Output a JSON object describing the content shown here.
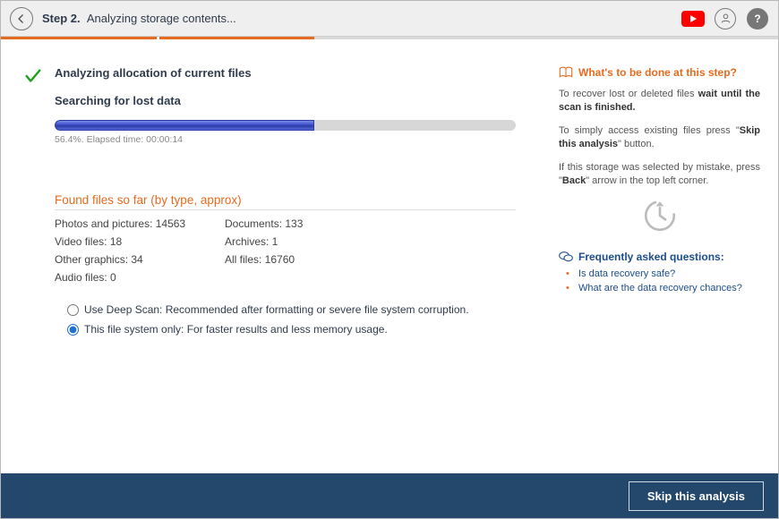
{
  "header": {
    "step_prefix": "Step 2.",
    "step_title": "Analyzing storage contents..."
  },
  "wizard_progress": {
    "done_pct": 41
  },
  "main": {
    "analyzing_title": "Analyzing allocation of current files",
    "searching_title": "Searching for lost data",
    "progress_pct": 56.4,
    "progress_caption": "56.4%. Elapsed time: 00:00:14",
    "found_heading": "Found files so far (by type, approx)",
    "found": {
      "photos": "Photos and pictures: 14563",
      "documents": "Documents: 133",
      "video": "Video files: 18",
      "archives": "Archives: 1",
      "other_graphics": "Other graphics: 34",
      "all_files": "All files: 16760",
      "audio": "Audio files: 0"
    },
    "options": {
      "deep_scan": "Use Deep Scan: Recommended after formatting or severe file system corruption.",
      "this_fs_only": "This file system only: For faster results and less memory usage.",
      "selected": "this_fs_only"
    }
  },
  "side": {
    "heading": "What's to be done at this step?",
    "p1_a": "To recover lost or deleted files ",
    "p1_b": "wait until the scan is finished.",
    "p2_a": "To simply access existing files press \"",
    "p2_b": "Skip this analysis",
    "p2_c": "\" button.",
    "p3_a": "If this storage was selected by mistake, press \"",
    "p3_b": "Back",
    "p3_c": "\" arrow in the top left corner.",
    "faq_heading": "Frequently asked questions:",
    "faq": [
      "Is data recovery safe?",
      "What are the data recovery chances?"
    ]
  },
  "footer": {
    "skip_label": "Skip this analysis"
  }
}
